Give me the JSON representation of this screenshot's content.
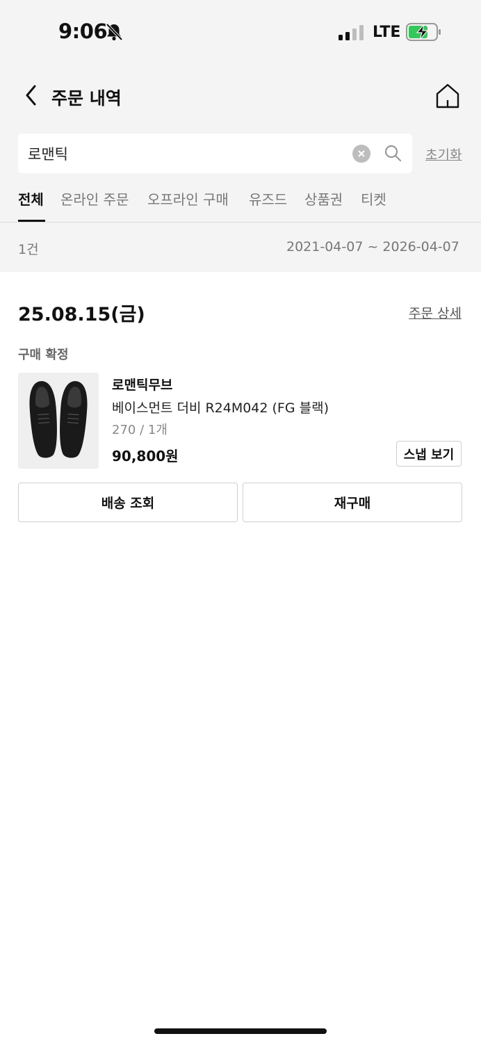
{
  "status_bar": {
    "time": "9:06",
    "network": "LTE"
  },
  "header": {
    "title": "주문 내역"
  },
  "search": {
    "value": "로맨틱",
    "reset_label": "초기화"
  },
  "tabs": [
    {
      "label": "전체",
      "active": true
    },
    {
      "label": "온라인 주문"
    },
    {
      "label": "오프라인 구매"
    },
    {
      "label": "유즈드"
    },
    {
      "label": "상품권"
    },
    {
      "label": "티켓"
    }
  ],
  "summary": {
    "count": "1건",
    "date_range": "2021-04-07 ~ 2026-04-07"
  },
  "order": {
    "date": "25.08.15(금)",
    "detail_label": "주문 상세",
    "status": "구매 확정",
    "item": {
      "brand": "로맨틱무브",
      "name": "베이스먼트 더비 R24M042 (FG 블랙)",
      "option": "270 / 1개",
      "price": "90,800원",
      "snap_label": "스냅 보기"
    },
    "actions": {
      "tracking": "배송 조회",
      "rebuy": "재구매"
    }
  },
  "colors": {
    "battery_green": "#34c759",
    "top_background": "#f4f4f4"
  },
  "icons": [
    "bell-slash-icon",
    "signal-icon",
    "battery-charging-icon",
    "back-chevron-icon",
    "home-icon",
    "clear-icon",
    "search-icon"
  ]
}
